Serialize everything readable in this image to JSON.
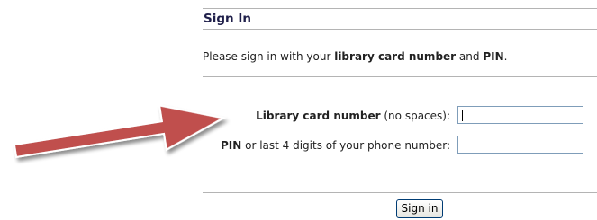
{
  "section": {
    "title": "Sign In"
  },
  "intro": {
    "prefix": "Please sign in with your ",
    "card_term": "library card number",
    "joiner": " and ",
    "pin_term": "PIN",
    "suffix": "."
  },
  "fields": {
    "card": {
      "label_bold": "Library card number",
      "label_rest": " (no spaces):",
      "value": ""
    },
    "pin": {
      "label_bold": "PIN",
      "label_rest": " or last 4 digits of your phone number:",
      "value": ""
    }
  },
  "actions": {
    "signin_label": "Sign in"
  },
  "annotation": {
    "arrow_color": "#c0504d",
    "arrow_icon": "right-arrow-icon"
  },
  "colors": {
    "title": "#1f1f4a",
    "input_border": "#7f9db9",
    "button_border": "#003c74"
  }
}
